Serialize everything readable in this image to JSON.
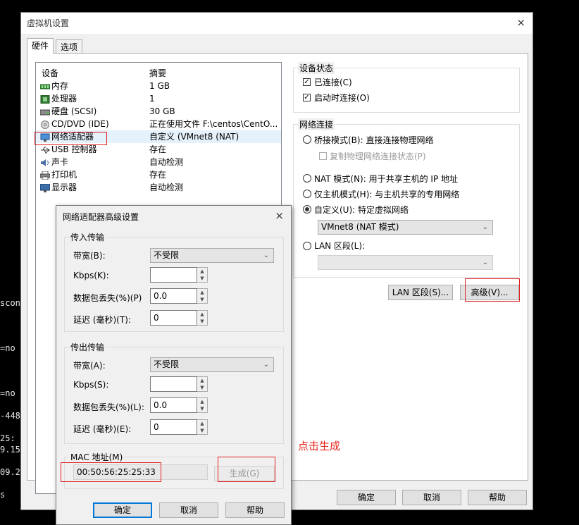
{
  "terminal": {
    "lines": [
      "scon",
      "=no",
      "=no",
      "-448",
      "25:",
      "9.15",
      "09.2",
      "s"
    ]
  },
  "main_window": {
    "title": "虚拟机设置",
    "close_glyph": "×",
    "tabs": [
      "硬件",
      "选项"
    ],
    "device_header": "设备",
    "summary_header": "摘要",
    "devices": [
      {
        "name": "内存",
        "summary": "1 GB",
        "icon": "memory-icon"
      },
      {
        "name": "处理器",
        "summary": "1",
        "icon": "cpu-icon"
      },
      {
        "name": "硬盘 (SCSI)",
        "summary": "30 GB",
        "icon": "harddisk-icon"
      },
      {
        "name": "CD/DVD (IDE)",
        "summary": "正在使用文件 F:\\centos\\CentO...",
        "icon": "cdrom-icon"
      },
      {
        "name": "网络适配器",
        "summary": "自定义 (VMnet8 (NAT)",
        "icon": "network-adapter-icon"
      },
      {
        "name": "USB 控制器",
        "summary": "存在",
        "icon": "usb-icon"
      },
      {
        "name": "声卡",
        "summary": "自动检测",
        "icon": "sound-icon"
      },
      {
        "name": "打印机",
        "summary": "存在",
        "icon": "printer-icon"
      },
      {
        "name": "显示器",
        "summary": "自动检测",
        "icon": "display-icon"
      }
    ],
    "device_status": {
      "title": "设备状态",
      "connected": {
        "label": "已连接(C)",
        "checked": true
      },
      "connect_at_power_on": {
        "label": "启动时连接(O)",
        "checked": true
      }
    },
    "network_connection": {
      "title": "网络连接",
      "bridged": "桥接模式(B): 直接连接物理网络",
      "replicate": "复制物理网络连接状态(P)",
      "nat": "NAT 模式(N): 用于共享主机的 IP 地址",
      "host_only": "仅主机模式(H): 与主机共享的专用网络",
      "custom": "自定义(U): 特定虚拟网络",
      "custom_value": "VMnet8 (NAT 模式)",
      "lan_segment": "LAN 区段(L):",
      "lan_segment_value": "",
      "selected": "custom"
    },
    "buttons": {
      "lan_segments": "LAN 区段(S)...",
      "advanced": "高级(V)...",
      "ok": "确定",
      "cancel": "取消",
      "help": "帮助"
    }
  },
  "dialog": {
    "title": "网络适配器高级设置",
    "close_glyph": "×",
    "incoming": {
      "title": "传入传输",
      "bandwidth_label": "带宽(B):",
      "bandwidth_value": "不受限",
      "kbps_label": "Kbps(K):",
      "kbps_value": "",
      "loss_label": "数据包丢失(%)(P)",
      "loss_value": "0.0",
      "latency_label": "延迟 (毫秒)(T):",
      "latency_value": "0"
    },
    "outgoing": {
      "title": "传出传输",
      "bandwidth_label": "带宽(A):",
      "bandwidth_value": "不受限",
      "kbps_label": "Kbps(S):",
      "kbps_value": "",
      "loss_label": "数据包丢失(%)(L):",
      "loss_value": "0.0",
      "latency_label": "延迟 (毫秒)(E):",
      "latency_value": "0"
    },
    "mac": {
      "label": "MAC 地址(M)",
      "value": "00:50:56:25:25:33",
      "generate": "生成(G)"
    },
    "buttons": {
      "ok": "确定",
      "cancel": "取消",
      "help": "帮助"
    }
  },
  "annotation": {
    "text": "点击生成",
    "color": "#e8231b"
  }
}
